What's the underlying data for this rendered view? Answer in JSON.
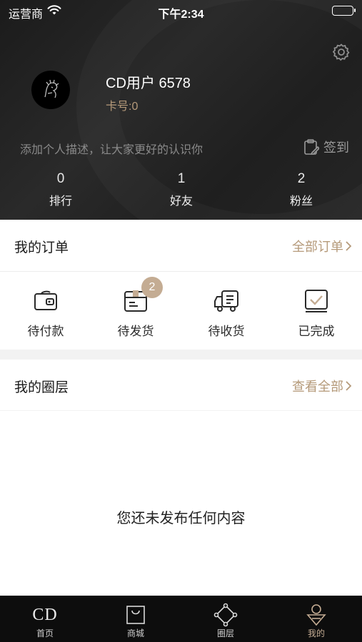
{
  "status_bar": {
    "carrier": "运营商",
    "time": "下午2:34"
  },
  "profile": {
    "username": "CD用户 6578",
    "card_number": "卡号:0",
    "description_placeholder": "添加个人描述，让大家更好的认识你",
    "checkin_label": "签到"
  },
  "stats": [
    {
      "value": "0",
      "label": "排行"
    },
    {
      "value": "1",
      "label": "好友"
    },
    {
      "value": "2",
      "label": "粉丝"
    }
  ],
  "orders_section": {
    "title": "我的订单",
    "more_label": "全部订单",
    "items": [
      {
        "label": "待付款",
        "icon": "wallet-icon",
        "badge": ""
      },
      {
        "label": "待发货",
        "icon": "package-icon",
        "badge": "2"
      },
      {
        "label": "待收货",
        "icon": "truck-icon",
        "badge": ""
      },
      {
        "label": "已完成",
        "icon": "completed-icon",
        "badge": ""
      }
    ]
  },
  "circle_section": {
    "title": "我的圈层",
    "more_label": "查看全部",
    "empty_text": "您还未发布任何内容"
  },
  "tabbar": {
    "items": [
      {
        "label": "首页",
        "icon": "cd-logo-icon",
        "active": false,
        "logo_text": "CD"
      },
      {
        "label": "商城",
        "icon": "shopping-bag-icon",
        "active": false
      },
      {
        "label": "圈层",
        "icon": "circle-network-icon",
        "active": false
      },
      {
        "label": "我的",
        "icon": "profile-icon",
        "active": true
      }
    ]
  },
  "colors": {
    "accent": "#c4ac93",
    "header_bg": "#1f1f1f",
    "tabbar_bg": "#0d0d0d"
  }
}
